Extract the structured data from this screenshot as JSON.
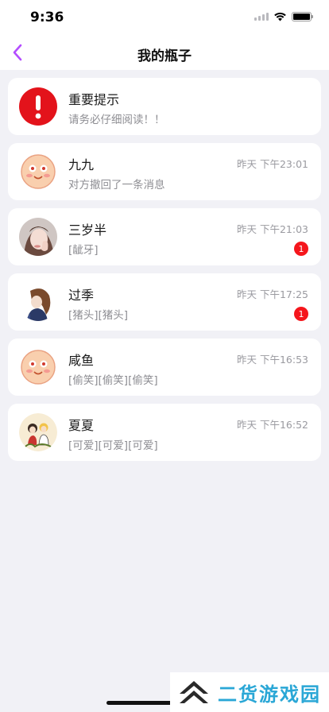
{
  "status_bar": {
    "time": "9:36"
  },
  "nav": {
    "title": "我的瓶子"
  },
  "notice": {
    "title": "重要提示",
    "subtitle": "请务必仔细阅读！！"
  },
  "conversations": [
    {
      "name": "九九",
      "preview": "对方撤回了一条消息",
      "time": "昨天 下午23:01",
      "avatar": "smiley-face"
    },
    {
      "name": "三岁半",
      "preview": "[龇牙]",
      "time": "昨天 下午21:03",
      "badge": "1",
      "avatar": "girl-photo"
    },
    {
      "name": "过季",
      "preview": "[猪头][猪头]",
      "time": "昨天 下午17:25",
      "badge": "1",
      "avatar": "anime-girl"
    },
    {
      "name": "咸鱼",
      "preview": "[偷笑][偷笑][偷笑]",
      "time": "昨天 下午16:53",
      "avatar": "smiley-face"
    },
    {
      "name": "夏夏",
      "preview": "[可爱][可爱][可爱]",
      "time": "昨天 下午16:52",
      "avatar": "cartoon-couple"
    }
  ],
  "watermark": {
    "text": "二货游戏园"
  },
  "colors": {
    "accent": "#b44dff",
    "badge": "#f5161c",
    "notice": "#e3131b",
    "background": "#f1f1f6"
  }
}
